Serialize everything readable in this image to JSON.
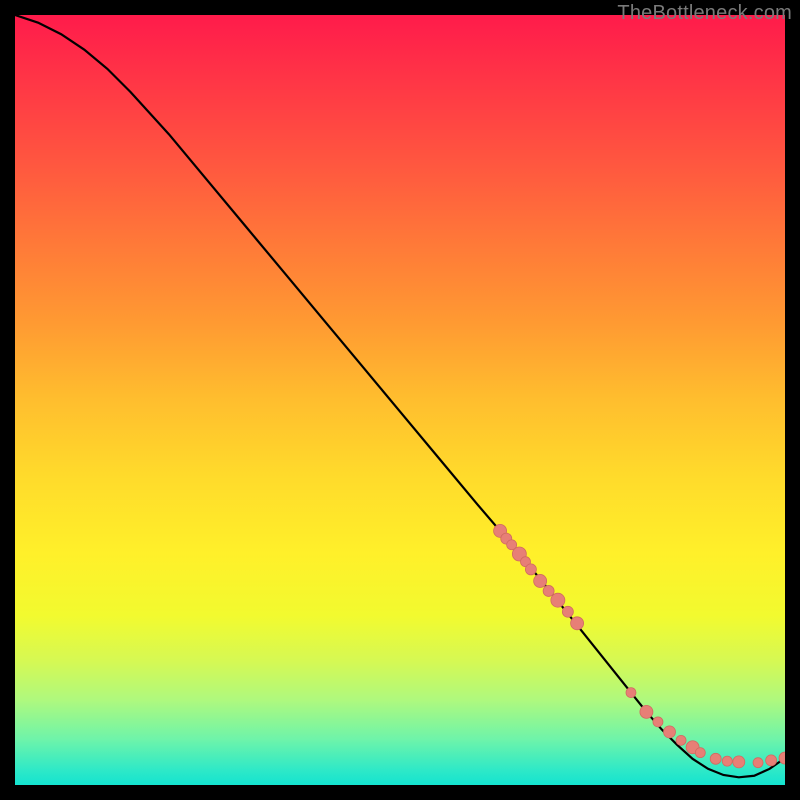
{
  "watermark": "TheBottleneck.com",
  "colors": {
    "line": "#000000",
    "marker_fill": "#e77f76",
    "marker_stroke": "#d16a61",
    "gradient_top": "#ff1b4b",
    "gradient_mid": "#ffdb2b",
    "gradient_bottom": "#14e3d0"
  },
  "chart_data": {
    "type": "line",
    "title": "",
    "xlabel": "",
    "ylabel": "",
    "xlim": [
      0,
      100
    ],
    "ylim": [
      0,
      100
    ],
    "grid": false,
    "legend": false,
    "series": [
      {
        "name": "bottleneck-curve",
        "x": [
          0,
          3,
          6,
          9,
          12,
          15,
          20,
          25,
          30,
          35,
          40,
          45,
          50,
          55,
          60,
          63,
          65,
          68,
          70,
          72,
          74,
          76,
          78,
          80,
          82,
          84,
          86,
          88,
          90,
          92,
          94,
          96,
          98,
          100
        ],
        "y": [
          100,
          99,
          97.5,
          95.5,
          93,
          90,
          84.5,
          78.5,
          72.5,
          66.5,
          60.5,
          54.5,
          48.5,
          42.5,
          36.5,
          33,
          30.5,
          27,
          24.5,
          22,
          19.5,
          17,
          14.5,
          12,
          9.5,
          7.2,
          5.2,
          3.4,
          2.1,
          1.3,
          1.0,
          1.2,
          2.1,
          3.5
        ]
      }
    ],
    "markers": {
      "name": "highlight-points",
      "x": [
        63.0,
        63.8,
        64.5,
        65.5,
        66.3,
        67.0,
        68.2,
        69.3,
        70.5,
        71.8,
        73.0,
        80.0,
        82.0,
        83.5,
        85.0,
        86.5,
        88.0,
        89.0,
        91.0,
        92.5,
        94.0,
        96.5,
        98.2,
        100.0
      ],
      "y": [
        33.0,
        32.0,
        31.2,
        30.0,
        29.0,
        28.0,
        26.5,
        25.2,
        24.0,
        22.5,
        21.0,
        12.0,
        9.5,
        8.2,
        6.9,
        5.8,
        4.9,
        4.2,
        3.4,
        3.1,
        3.0,
        2.9,
        3.2,
        3.5
      ],
      "r": [
        6.5,
        5.5,
        5.0,
        7.0,
        5.0,
        5.5,
        6.5,
        5.5,
        7.0,
        5.5,
        6.5,
        5.0,
        6.5,
        5.0,
        6.0,
        5.0,
        6.5,
        5.0,
        5.5,
        5.0,
        6.0,
        5.0,
        5.5,
        6.0
      ]
    }
  }
}
